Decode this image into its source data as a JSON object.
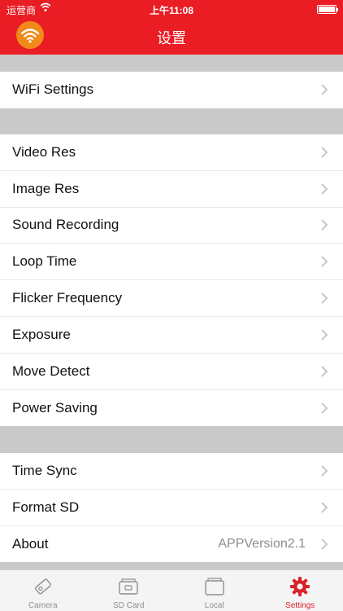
{
  "status_bar": {
    "carrier": "运营商",
    "time": "上午11:08"
  },
  "nav": {
    "title": "设置",
    "logo_icon": "wifi-logo-icon"
  },
  "groups": {
    "wifi": [
      {
        "label": "WiFi Settings"
      }
    ],
    "camera": [
      {
        "label": "Video Res"
      },
      {
        "label": "Image Res"
      },
      {
        "label": "Sound Recording"
      },
      {
        "label": "Loop Time"
      },
      {
        "label": "Flicker Frequency"
      },
      {
        "label": "Exposure"
      },
      {
        "label": "Move Detect"
      },
      {
        "label": "Power Saving"
      }
    ],
    "system": [
      {
        "label": "Time Sync"
      },
      {
        "label": "Format SD"
      },
      {
        "label": "About",
        "value": "APPVersion2.1"
      }
    ]
  },
  "tabbar": [
    {
      "label": "Camera",
      "icon": "camera-icon"
    },
    {
      "label": "SD Card",
      "icon": "sd-card-icon"
    },
    {
      "label": "Local",
      "icon": "local-folder-icon"
    },
    {
      "label": "Settings",
      "icon": "gear-icon"
    }
  ],
  "colors": {
    "accent": "#ea1c24",
    "logo": "#f28a1a",
    "background": "#c9c9c9"
  }
}
